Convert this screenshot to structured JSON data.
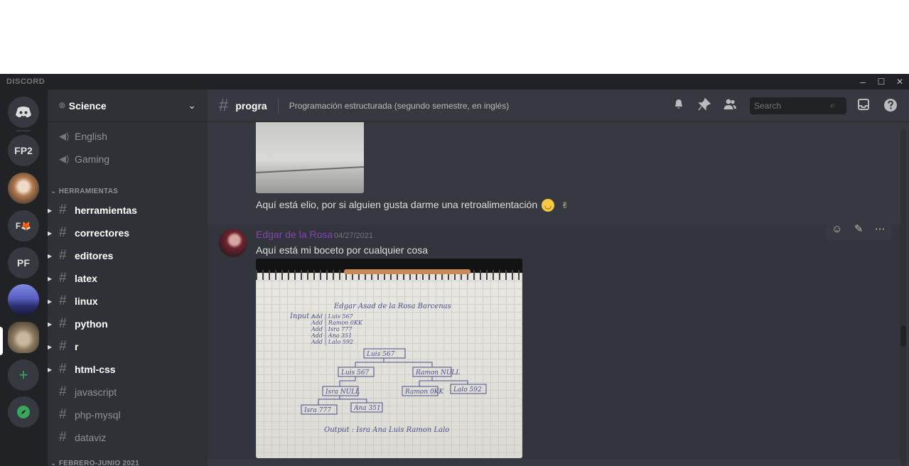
{
  "window": {
    "wordmark": "DISCORD",
    "minimize": "–",
    "maximize": "☐",
    "close": "✕"
  },
  "servers": [
    {
      "name": "home",
      "label": ""
    },
    {
      "name": "FP2",
      "label": "FP2"
    },
    {
      "name": "teddy",
      "label": ""
    },
    {
      "name": "F-fox",
      "label": "F🦊"
    },
    {
      "name": "PF",
      "label": "PF"
    },
    {
      "name": "landscape",
      "label": ""
    },
    {
      "name": "cat",
      "label": ""
    },
    {
      "name": "add",
      "label": "+"
    },
    {
      "name": "explore",
      "label": "●"
    }
  ],
  "guild": {
    "name": "Science",
    "badge": "◎"
  },
  "voice_channels": [
    {
      "name": "English"
    },
    {
      "name": "Gaming"
    }
  ],
  "categories": {
    "herramientas": "HERRAMIENTAS",
    "febrero": "FEBRERO-JUNIO 2021"
  },
  "text_channels": [
    {
      "name": "herramientas",
      "unread": true
    },
    {
      "name": "correctores",
      "unread": true
    },
    {
      "name": "editores",
      "unread": true
    },
    {
      "name": "latex",
      "unread": true
    },
    {
      "name": "linux",
      "unread": true
    },
    {
      "name": "python",
      "unread": true
    },
    {
      "name": "r",
      "unread": true
    },
    {
      "name": "html-css",
      "unread": true
    },
    {
      "name": "javascript",
      "unread": false
    },
    {
      "name": "php-mysql",
      "unread": false
    },
    {
      "name": "dataviz",
      "unread": false
    }
  ],
  "channel": {
    "name": "progra",
    "topic": "Programación estructurada (segundo semestre, en inglés)"
  },
  "search": {
    "placeholder": "Search"
  },
  "messages": {
    "previous_text": "Aquí está elio, por si alguien gusta darme una retroalimentación",
    "author": "Edgar de la Rosa",
    "timestamp": "04/27/2021",
    "text": "Aquí está mi boceto por cualquier cosa"
  },
  "sketch": {
    "title": "Edgar Asad de la Rosa Barcenas",
    "input_label": "Input :",
    "inputs": [
      "Add | Luis 567",
      "Add | Ramon 0KK",
      "Add | Isra 777",
      "Add | Ana 351",
      "Add | Lalo 592"
    ],
    "tree": [
      "Luis 567",
      "Luis 567",
      "Ramon NULL",
      "Isra NULL",
      "Ramon 0KK",
      "Lalo 592",
      "Isra 777",
      "Ana 351"
    ],
    "output": "Output :   Isra   Ana   Luis   Ramon   Lalo"
  },
  "colors": {
    "username": "#8a3fb5",
    "accent_green": "#3ba55d"
  }
}
